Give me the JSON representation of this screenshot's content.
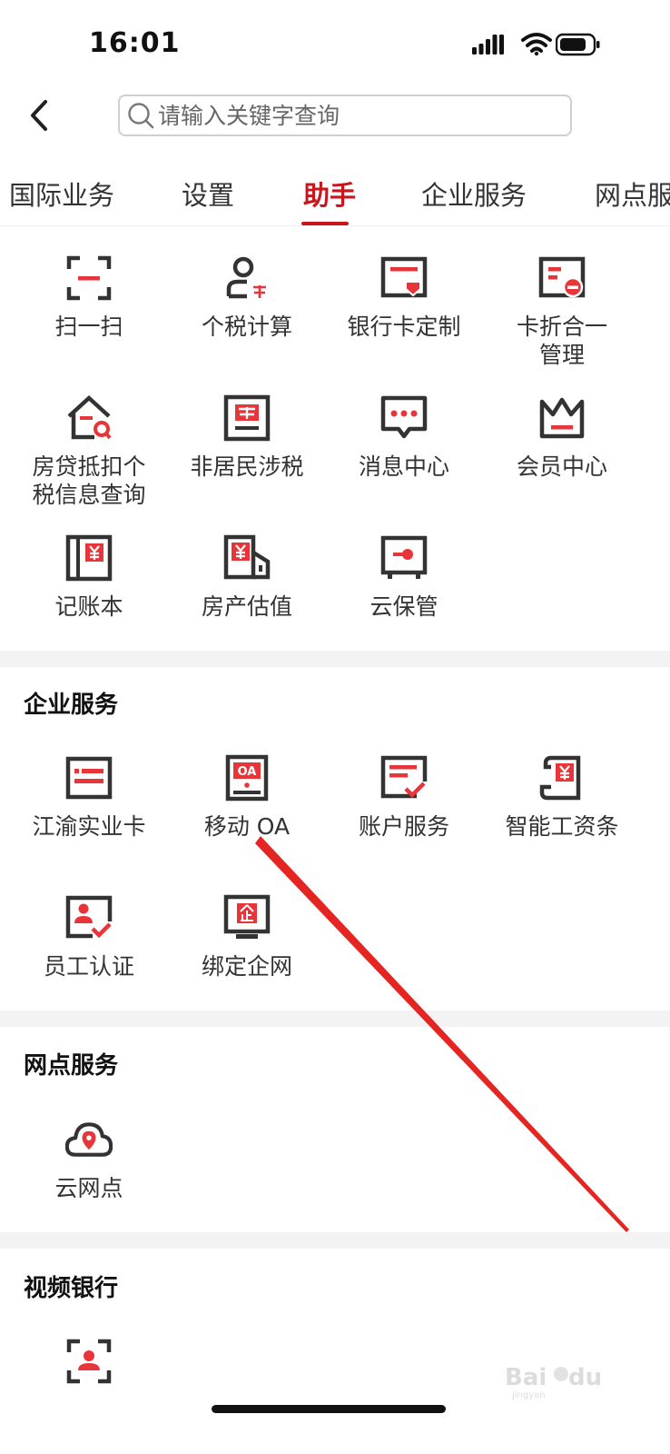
{
  "status_bar": {
    "time": "16:01"
  },
  "search": {
    "placeholder": "请输入关键字查询"
  },
  "tabs": [
    {
      "label": "国际业务"
    },
    {
      "label": "设置"
    },
    {
      "label": "助手",
      "active": true
    },
    {
      "label": "企业服务"
    },
    {
      "label": "网点服务"
    }
  ],
  "assistant": {
    "items": [
      {
        "label": "扫一扫",
        "icon": "scan-icon"
      },
      {
        "label": "个税计算",
        "icon": "tax-person-icon"
      },
      {
        "label": "银行卡定制",
        "icon": "card-custom-icon"
      },
      {
        "label": "卡折合一\n管理",
        "icon": "card-manage-icon"
      },
      {
        "label": "房贷抵扣个\n税信息查询",
        "icon": "house-search-icon"
      },
      {
        "label": "非居民涉税",
        "icon": "tax-document-icon"
      },
      {
        "label": "消息中心",
        "icon": "message-icon"
      },
      {
        "label": "会员中心",
        "icon": "crown-icon"
      },
      {
        "label": "记账本",
        "icon": "ledger-icon"
      },
      {
        "label": "房产估值",
        "icon": "property-value-icon"
      },
      {
        "label": "云保管",
        "icon": "safe-box-icon"
      }
    ]
  },
  "enterprise": {
    "title": "企业服务",
    "items": [
      {
        "label": "江渝实业卡",
        "icon": "business-card-icon"
      },
      {
        "label": "移动 OA",
        "icon": "mobile-oa-icon"
      },
      {
        "label": "账户服务",
        "icon": "account-service-icon"
      },
      {
        "label": "智能工资条",
        "icon": "salary-slip-icon"
      },
      {
        "label": "员工认证",
        "icon": "employee-verify-icon"
      },
      {
        "label": "绑定企网",
        "icon": "enterprise-bind-icon"
      }
    ]
  },
  "outlet": {
    "title": "网点服务",
    "items": [
      {
        "label": "云网点",
        "icon": "cloud-location-icon"
      }
    ]
  },
  "video": {
    "title": "视频银行",
    "items": [
      {
        "label": "",
        "icon": "video-scan-icon"
      }
    ]
  },
  "colors": {
    "accent": "#c8161d",
    "icon_dark": "#333333",
    "icon_red": "#e8353a"
  }
}
